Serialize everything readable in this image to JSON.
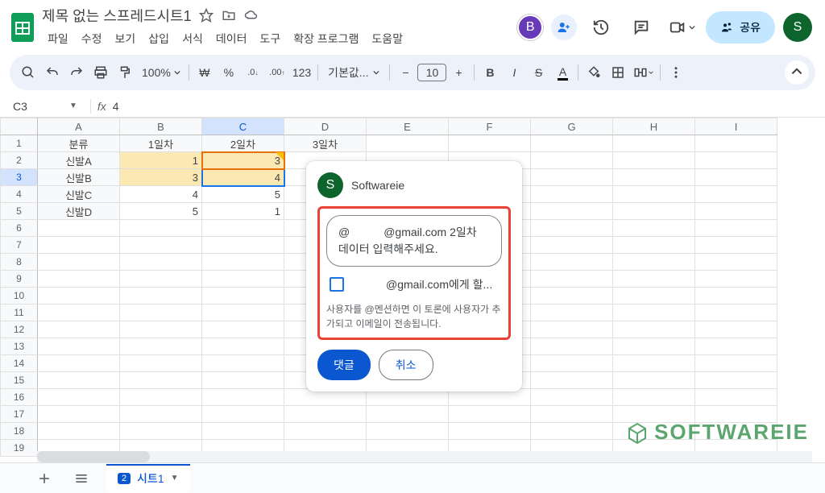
{
  "header": {
    "title": "제목 없는 스프레드시트1",
    "menus": [
      "파일",
      "수정",
      "보기",
      "삽입",
      "서식",
      "데이터",
      "도구",
      "확장 프로그램",
      "도움말"
    ],
    "avatar_letter": "B",
    "share_label": "공유",
    "profile_letter": "S"
  },
  "toolbar": {
    "zoom": "100%",
    "currency": "₩",
    "percent": "%",
    "dec_dec": ".0",
    "dec_inc": ".00",
    "num_fmt": "123",
    "font": "기본값...",
    "font_size": "10"
  },
  "formula_bar": {
    "cell_ref": "C3",
    "fx": "fx",
    "value": "4"
  },
  "grid": {
    "columns": [
      "A",
      "B",
      "C",
      "D",
      "E",
      "F",
      "G",
      "H",
      "I"
    ],
    "rows": [
      "1",
      "2",
      "3",
      "4",
      "5",
      "6",
      "7",
      "8",
      "9",
      "10",
      "11",
      "12",
      "13",
      "14",
      "15",
      "16",
      "17",
      "18",
      "19"
    ],
    "headers": [
      "분류",
      "1일차",
      "2일차",
      "3일차"
    ],
    "data": [
      [
        "신발A",
        "1",
        "3",
        ""
      ],
      [
        "신발B",
        "3",
        "4",
        ""
      ],
      [
        "신발C",
        "4",
        "5",
        ""
      ],
      [
        "신발D",
        "5",
        "1",
        ""
      ]
    ],
    "selected_col": "C",
    "selected_row": "3"
  },
  "comment": {
    "author": "Softwareie",
    "author_initial": "S",
    "text": "@　　　@gmail.com 2일차 데이터 입력해주세요.",
    "assign_label": "　　　@gmail.com에게 할...",
    "hint": "사용자를 @멘션하면 이 토론에 사용자가 추가되고 이메일이 전송됩니다.",
    "submit": "댓글",
    "cancel": "취소"
  },
  "sheet_tabs": {
    "badge": "2",
    "name": "시트1"
  },
  "watermark": {
    "text": "SOFTWAREIE"
  }
}
